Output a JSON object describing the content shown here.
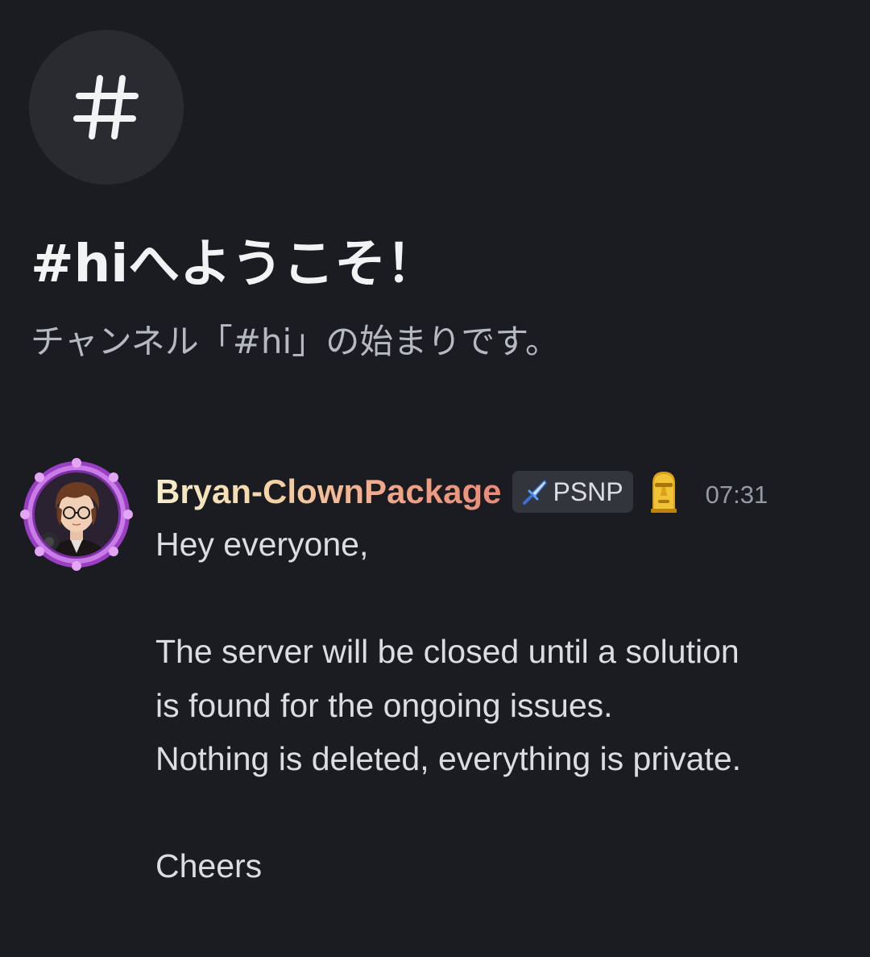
{
  "channel": {
    "icon": "hashtag-icon",
    "welcome_title": "#hiへようこそ！",
    "welcome_subtitle": "チャンネル「#hi」の始まりです。"
  },
  "message": {
    "author": "Bryan-ClownPackage",
    "tag": {
      "icon": "sword-icon",
      "label": "PSNP"
    },
    "badge_icon": "moai-icon",
    "timestamp": "07:31",
    "lines": [
      "Hey everyone,",
      "",
      "The server will be closed until a solution",
      "is found for the ongoing issues.",
      "Nothing is deleted, everything is private.",
      "",
      "Cheers"
    ]
  },
  "colors": {
    "background": "#1b1c21",
    "icon_circle": "#2a2b31",
    "title": "#f2f3f5",
    "subtitle": "#b5bac1",
    "message_text": "#dbdee1",
    "timestamp": "#949ba4",
    "tag_background": "#33353c",
    "avatar_frame": "#b45bd6"
  }
}
